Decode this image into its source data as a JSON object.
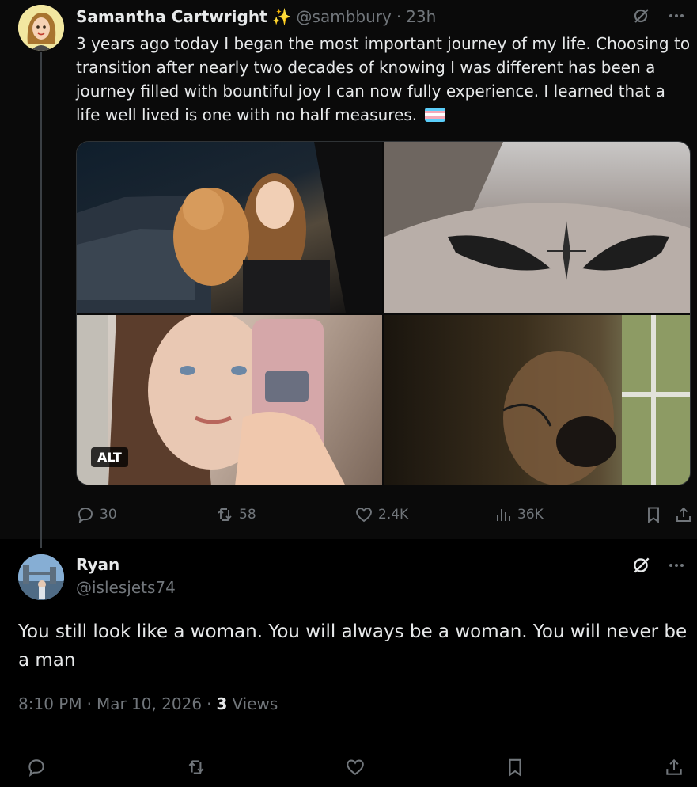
{
  "parent_tweet": {
    "author_name": "Samantha Cartwright",
    "author_emoji": "✨",
    "handle": "@sambbury",
    "separator": "·",
    "time_ago": "23h",
    "text": "3 years ago today I began the most important journey of my life. Choosing to transition after nearly two decades of knowing I was different has been a journey filled with bountiful joy I can now fully experience. I learned that a life well lived is one with no half measures.",
    "flag_colors": [
      "#5BCEFA",
      "#F5A9B8",
      "#FFFFFF",
      "#F5A9B8",
      "#5BCEFA"
    ],
    "alt_badge": "ALT",
    "replies": "30",
    "reposts": "58",
    "likes": "2.4K",
    "views": "36K"
  },
  "reply_tweet": {
    "author_name": "Ryan",
    "handle": "@islesjets74",
    "text": "You still look like a woman. You will always be a woman. You will never be a man",
    "time": "8:10 PM",
    "date": "Mar 10, 2026",
    "views_count": "3",
    "views_label": "Views",
    "dot": "·"
  },
  "colors": {
    "muted": "#71767b",
    "text": "#e7e9ea",
    "background": "#000000",
    "sparkle": "#f4c542"
  }
}
